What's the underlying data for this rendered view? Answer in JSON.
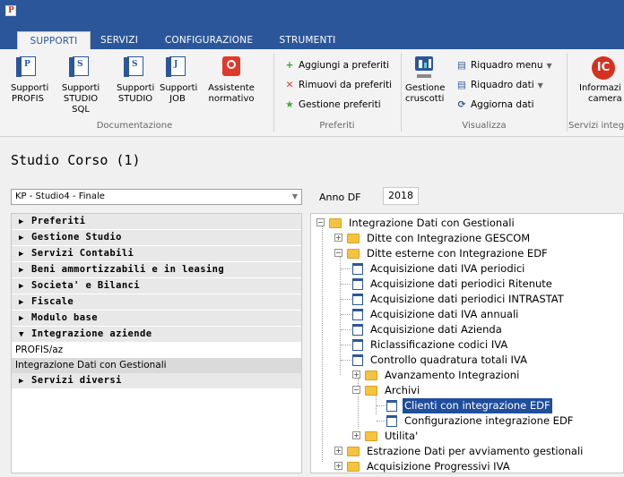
{
  "app": {
    "icon_letter": "P"
  },
  "tabs": [
    "SUPPORTI",
    "SERVIZI",
    "CONFIGURAZIONE",
    "STRUMENTI"
  ],
  "ribbon": {
    "documentazione": {
      "label": "Documentazione",
      "buttons": [
        {
          "line1": "Supporti",
          "line2": "PROFIS",
          "letter": "P"
        },
        {
          "line1": "Supporti",
          "line2": "STUDIO SQL",
          "letter": "S"
        },
        {
          "line1": "Supporti",
          "line2": "STUDIO",
          "letter": "S"
        },
        {
          "line1": "Supporti",
          "line2": "JOB",
          "letter": "J"
        },
        {
          "line1": "Assistente",
          "line2": "normativo"
        }
      ]
    },
    "preferiti": {
      "label": "Preferiti",
      "add": "Aggiungi a preferiti",
      "remove": "Rimuovi da preferiti",
      "manage": "Gestione preferiti"
    },
    "visualizza": {
      "label": "Visualizza",
      "gestione_line1": "Gestione",
      "gestione_line2": "cruscotti",
      "riquadro_menu": "Riquadro menu",
      "riquadro_dati": "Riquadro dati",
      "aggiorna": "Aggiorna dati"
    },
    "servizi": {
      "label": "Servizi integ",
      "info_line1": "Informazi",
      "info_line2": "camera",
      "badge": "IC"
    }
  },
  "header": {
    "title": "Studio Corso (1)"
  },
  "combo": {
    "value": "KP - Studio4 - Finale"
  },
  "anno": {
    "label": "Anno DF",
    "value": "2018"
  },
  "left_menu": {
    "items": [
      {
        "label": "Preferiti",
        "tri": "▶"
      },
      {
        "label": "Gestione Studio",
        "tri": "▶"
      },
      {
        "label": "Servizi Contabili",
        "tri": "▶"
      },
      {
        "label": "Beni ammortizzabili e in leasing",
        "tri": "▶"
      },
      {
        "label": "Societa' e Bilanci",
        "tri": "▶"
      },
      {
        "label": "Fiscale",
        "tri": "▶"
      },
      {
        "label": "Modulo base",
        "tri": "▶"
      },
      {
        "label": "Integrazione aziende",
        "tri": "▼"
      }
    ],
    "sub1": "PROFIS/az",
    "sub2": "Integrazione Dati con Gestionali",
    "last": {
      "label": "Servizi diversi",
      "tri": "▶"
    }
  },
  "tree": {
    "root": "Integrazione Dati con Gestionali",
    "n1": "Ditte con Integrazione GESCOM",
    "n2": "Ditte esterne con Integrazione EDF",
    "n2_children": [
      "Acquisizione dati IVA periodici",
      "Acquisizione dati periodici Ritenute",
      "Acquisizione dati periodici INTRASTAT",
      "Acquisizione dati IVA annuali",
      "Acquisizione dati Azienda",
      "Riclassificazione codici IVA",
      "Controllo quadratura totali IVA"
    ],
    "avanzamento": "Avanzamento Integrazioni",
    "archivi": "Archivi",
    "clienti": "Clienti con integrazione EDF",
    "configurazione": "Configurazione integrazione EDF",
    "utilita": "Utilita'",
    "estrazione": "Estrazione Dati per avviamento gestionali",
    "progressivi": "Acquisizione Progressivi IVA"
  }
}
